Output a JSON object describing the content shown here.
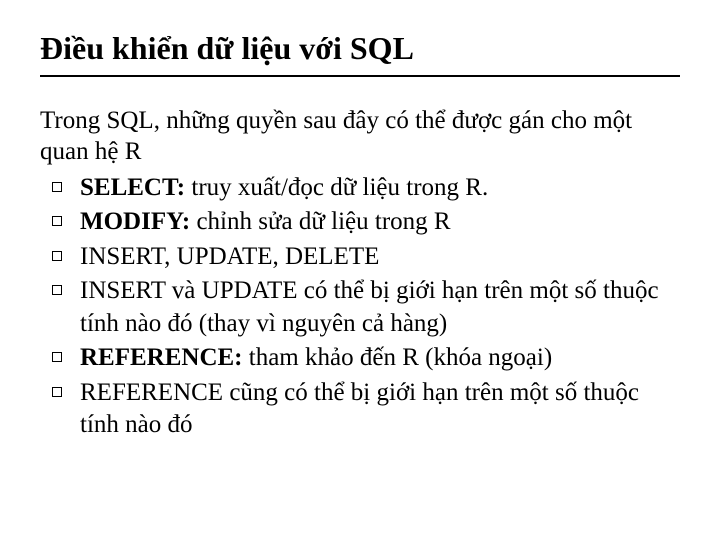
{
  "title": "Điều khiển dữ liệu với SQL",
  "intro": "Trong SQL, những quyền sau đây có thể được gán cho một quan hệ R",
  "bullets": [
    {
      "prefix": "SELECT:",
      "rest": " truy xuất/đọc dữ liệu trong R."
    },
    {
      "prefix": "MODIFY:",
      "rest": " chỉnh sửa dữ liệu trong R"
    },
    {
      "prefix": "",
      "rest": "INSERT, UPDATE, DELETE"
    },
    {
      "prefix": "",
      "rest": "INSERT và UPDATE có thể bị giới hạn trên một số thuộc tính nào đó (thay vì nguyên cả hàng)"
    },
    {
      "prefix": "REFERENCE:",
      "rest": " tham khảo đến R (khóa ngoại)"
    },
    {
      "prefix": "",
      "rest": "REFERENCE cũng có thể bị giới hạn trên một số thuộc tính nào đó"
    }
  ]
}
